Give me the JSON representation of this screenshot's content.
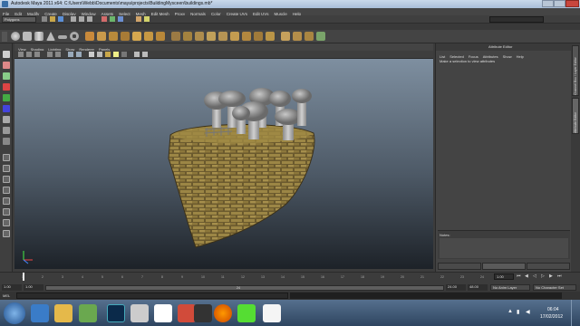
{
  "window": {
    "title": "Autodesk Maya 2011 x64: C:\\Users\\Webb\\Documents\\maya\\projects\\BuildingMysceen\\buildings.mb*"
  },
  "menubar": {
    "items": [
      "File",
      "Edit",
      "Modify",
      "Create",
      "Display",
      "Window",
      "Assets",
      "Select",
      "Mesh",
      "Edit Mesh",
      "Proxy",
      "Normals",
      "Color",
      "Create UVs",
      "Edit UVs",
      "Muscle",
      "Help"
    ]
  },
  "statusline": {
    "mode": "Polygons"
  },
  "shelf_tabs": {
    "items": [
      "General",
      "Curves",
      "Surfaces",
      "Polygons",
      "Subdivs",
      "Deformation",
      "Animation",
      "Dynamics",
      "Rendering",
      "PaintEffects",
      "Toon",
      "Muscle",
      "Fluids",
      "Fur",
      "Hair",
      "nCloth",
      "Custom"
    ],
    "active_index": 3
  },
  "panel_menu": {
    "items": [
      "View",
      "Shading",
      "Lighting",
      "Show",
      "Renderer",
      "Panels"
    ]
  },
  "viewport": {
    "camera_label": "persp"
  },
  "attribute_editor": {
    "title": "Attribute Editor",
    "menu": [
      "List",
      "Selected",
      "Focus",
      "Attributes",
      "Show",
      "Help"
    ],
    "message": "Make a selection to view attributes",
    "notes_label": "Notes:",
    "buttons": [
      "Select",
      "Load Attributes",
      "Copy Tab"
    ]
  },
  "side_tabs": [
    "Channel Box / Layer Editor",
    "Attribute Editor"
  ],
  "time_slider": {
    "ticks": [
      "1",
      "2",
      "3",
      "4",
      "5",
      "6",
      "7",
      "8",
      "9",
      "10",
      "11",
      "12",
      "13",
      "14",
      "15",
      "16",
      "17",
      "18",
      "19",
      "20",
      "21",
      "22",
      "23",
      "24"
    ],
    "current_frame": "1.00"
  },
  "range_slider": {
    "start": "1.00",
    "inner_start": "1.00",
    "inner_end": "24",
    "end": "24.00",
    "end2": "48.00",
    "anim_layer": "No Anim Layer",
    "char_set": "No Character Set"
  },
  "command_line": {
    "lang": "MEL"
  },
  "taskbar": {
    "time": "06:04",
    "date": "17/02/2012"
  }
}
